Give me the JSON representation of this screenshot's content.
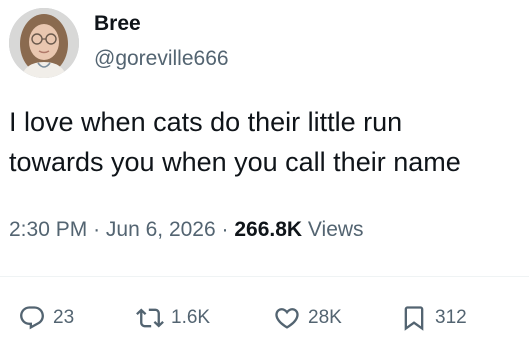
{
  "author": {
    "name": "Bree",
    "handle": "@goreville666",
    "avatar_icon": "profile-photo"
  },
  "tweet": {
    "text_lines": [
      "I love when cats do their little run",
      "towards you when you call their name"
    ]
  },
  "meta": {
    "time": "2:30 PM",
    "separator": "·",
    "date": "Jun 6, 2026",
    "views_count": "266.8K",
    "views_label": "Views"
  },
  "actions": {
    "reply": {
      "count": "23",
      "icon": "reply-icon"
    },
    "retweet": {
      "count": "1.6K",
      "icon": "retweet-icon"
    },
    "like": {
      "count": "28K",
      "icon": "heart-icon"
    },
    "bookmark": {
      "count": "312",
      "icon": "bookmark-icon"
    }
  },
  "colors": {
    "text_primary": "#0f1419",
    "text_secondary": "#536471",
    "divider": "#eff3f4"
  }
}
